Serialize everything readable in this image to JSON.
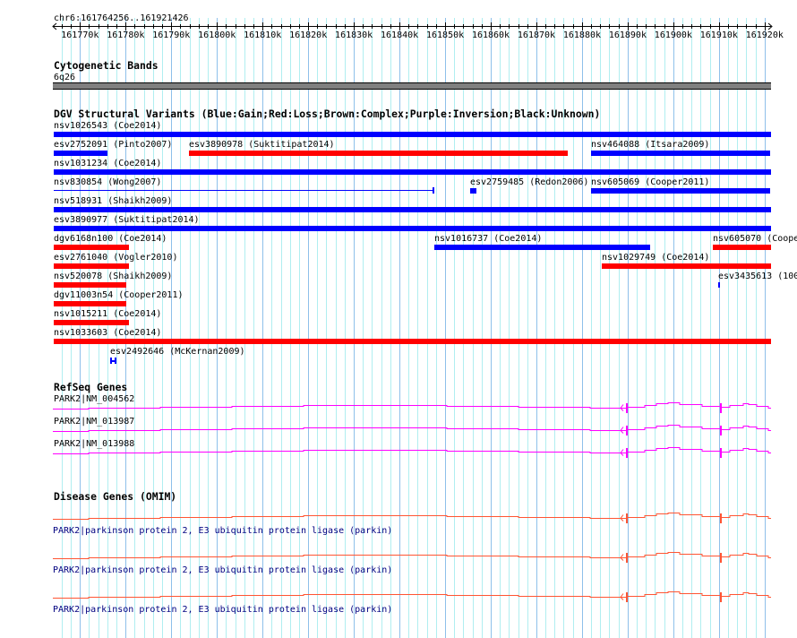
{
  "view": {
    "chrom": "chr6",
    "start": 161764256,
    "end": 161921426,
    "location_label": "chr6:161764256..161921426"
  },
  "ruler": {
    "ticks": [
      "161770k",
      "161780k",
      "161790k",
      "161800k",
      "161810k",
      "161820k",
      "161830k",
      "161840k",
      "161850k",
      "161860k",
      "161870k",
      "161880k",
      "161890k",
      "161900k",
      "161910k",
      "161920k"
    ]
  },
  "cytoband": {
    "title": "Cytogenetic Bands",
    "band": "6q26",
    "color": "#808080"
  },
  "dgv": {
    "title": "DGV Structural Variants (Blue:Gain;Red:Loss;Brown:Complex;Purple:Inversion;Black:Unknown)",
    "colors": {
      "gain": "#0000ff",
      "loss": "#ff0000"
    },
    "rows": [
      [
        {
          "label": "nsv1026543 (Coe2014)",
          "type": "gain",
          "start": 161764256,
          "end": 161921426
        }
      ],
      [
        {
          "label": "esv2752091 (Pinto2007)",
          "type": "gain",
          "start": 161764256,
          "end": 161776028
        },
        {
          "label": "esv3890978 (Suktitipat2014)",
          "type": "loss",
          "start": 161793882,
          "end": 161876875
        },
        {
          "label": "nsv464088 (Itsara2009)",
          "type": "gain",
          "start": 161881976,
          "end": 161921226
        }
      ],
      [
        {
          "label": "nsv1031234 (Coe2014)",
          "type": "gain",
          "start": 161764256,
          "end": 161921426
        }
      ],
      [
        {
          "label": "nsv830854 (Wong2007)",
          "type": "gain",
          "style": "thin",
          "start": 161764256,
          "end": 161847641
        },
        {
          "label": "esv2759485 (Redon2006)",
          "type": "gain",
          "start": 161855489,
          "end": 161856862
        },
        {
          "label": "nsv605069 (Cooper2011)",
          "type": "gain",
          "start": 161881976,
          "end": 161921226
        }
      ],
      [
        {
          "label": "nsv518931 (Shaikh2009)",
          "type": "gain",
          "start": 161764256,
          "end": 161921426
        }
      ],
      [
        {
          "label": "esv3890977 (Suktitipat2014)",
          "type": "gain",
          "start": 161764256,
          "end": 161921426
        }
      ],
      [
        {
          "label": "dgv6168n100 (Coe2014)",
          "type": "loss",
          "start": 161764256,
          "end": 161780737
        },
        {
          "label": "nsv1016737 (Coe2014)",
          "type": "gain",
          "start": 161847641,
          "end": 161894925
        },
        {
          "label": "nsv605070 (Coope",
          "type": "loss",
          "start": 161908660,
          "end": 161921426
        }
      ],
      [
        {
          "label": "esv2761040 (Vogler2010)",
          "type": "loss",
          "start": 161764256,
          "end": 161780737
        },
        {
          "label": "nsv1029749 (Coe2014)",
          "type": "loss",
          "start": 161884330,
          "end": 161921426
        }
      ],
      [
        {
          "label": "nsv520078 (Shaikh2009)",
          "type": "loss",
          "start": 161764256,
          "end": 161780148
        },
        {
          "label": "esv3435613 (100",
          "type": "gain",
          "start": 161909837,
          "end": 161910230
        }
      ],
      [
        {
          "label": "dgv11003n54 (Cooper2011)",
          "type": "loss",
          "start": 161764256,
          "end": 161780148
        }
      ],
      [
        {
          "label": "nsv1015211 (Coe2014)",
          "type": "loss",
          "start": 161764256,
          "end": 161780737
        }
      ],
      [
        {
          "label": "nsv1033603 (Coe2014)",
          "type": "loss",
          "start": 161764256,
          "end": 161921426
        }
      ],
      [
        {
          "label": "esv2492646 (McKernan2009)",
          "type": "gain",
          "style": "H",
          "start": 161776617,
          "end": 161777990
        }
      ]
    ]
  },
  "refseq": {
    "title": "RefSeq Genes",
    "color": "#ff00ff",
    "genes": [
      {
        "label": "PARK2|NM_004562"
      },
      {
        "label": "PARK2|NM_013987"
      },
      {
        "label": "PARK2|NM_013988"
      }
    ]
  },
  "omim": {
    "title": "Disease Genes (OMIM)",
    "color": "#ff5533",
    "genes": [
      {
        "label": "PARK2|parkinson protein 2, E3 ubiquitin protein ligase (parkin)"
      },
      {
        "label": "PARK2|parkinson protein 2, E3 ubiquitin protein ligase (parkin)"
      },
      {
        "label": "PARK2|parkinson protein 2, E3 ubiquitin protein ligase (parkin)"
      }
    ]
  }
}
